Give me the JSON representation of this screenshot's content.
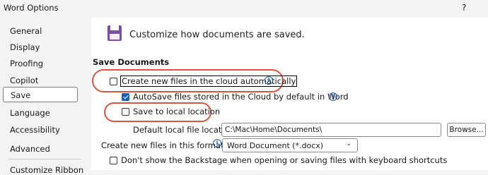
{
  "window": {
    "title": "Word Options",
    "help_label": "?"
  },
  "sidebar": {
    "items": [
      {
        "label": "General"
      },
      {
        "label": "Display"
      },
      {
        "label": "Proofing"
      },
      {
        "label": "Copilot"
      },
      {
        "label": "Save",
        "selected": true
      },
      {
        "label": "Language"
      },
      {
        "label": "Accessibility"
      },
      {
        "label": "Advanced"
      },
      {
        "label": "Customize Ribbon"
      }
    ]
  },
  "main": {
    "header_text": "Customize how documents are saved.",
    "section_title": "Save Documents",
    "options": {
      "cloud_new_files": {
        "label": "Create new files in the cloud automatically",
        "checked": false
      },
      "autosave_cloud": {
        "label": "AutoSave files stored in the Cloud by default in Word",
        "checked": true
      },
      "save_local": {
        "label": "Save to local location",
        "checked": false
      },
      "default_local_location": {
        "label": "Default local file location:",
        "value": "C:\\Mac\\Home\\Documents\\"
      },
      "browse_button": {
        "label": "Browse..."
      },
      "new_file_format": {
        "label": "Create new files in this format:",
        "selected": "Word Document (*.docx)"
      },
      "hide_backstage": {
        "label": "Don't show the Backstage when opening or saving files with keyboard shortcuts",
        "checked": false
      }
    }
  },
  "colors": {
    "accent": "#1d61b5",
    "highlight_oval": "#d9543f",
    "save_icon": "#7b4ea3"
  },
  "icons": {
    "header": "save-floppy-icon",
    "info": "info-icon",
    "dropdown": "chevron-down-icon"
  }
}
